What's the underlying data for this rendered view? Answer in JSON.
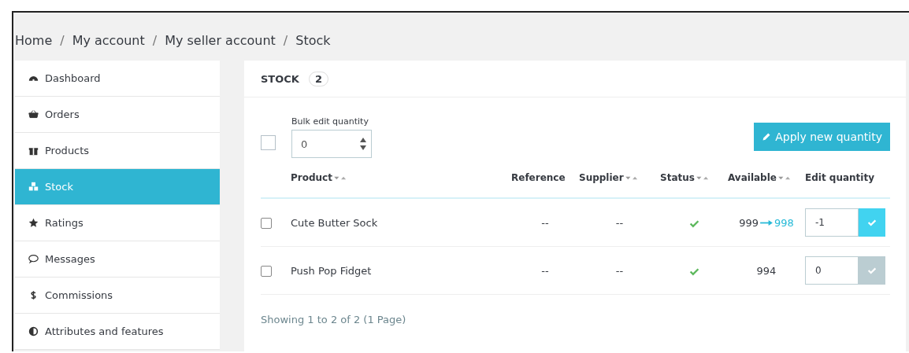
{
  "breadcrumb": [
    "Home",
    "My account",
    "My seller account",
    "Stock"
  ],
  "breadcrumb_separator": "/",
  "sidebar": {
    "items": [
      {
        "label": "Dashboard",
        "selected": false
      },
      {
        "label": "Orders",
        "selected": false
      },
      {
        "label": "Products",
        "selected": false
      },
      {
        "label": "Stock",
        "selected": true
      },
      {
        "label": "Ratings",
        "selected": false
      },
      {
        "label": "Messages",
        "selected": false
      },
      {
        "label": "Commissions",
        "selected": false
      },
      {
        "label": "Attributes and features",
        "selected": false
      }
    ]
  },
  "panel": {
    "title": "STOCK",
    "count": "2",
    "bulk": {
      "checked": false,
      "label": "Bulk edit quantity",
      "value": "0",
      "button": "Apply new quantity"
    },
    "table": {
      "columns": [
        {
          "label": "Product",
          "sortable": true
        },
        {
          "label": "Reference",
          "sortable": false
        },
        {
          "label": "Supplier",
          "sortable": true
        },
        {
          "label": "Status",
          "sortable": true
        },
        {
          "label": "Available",
          "sortable": true
        },
        {
          "label": "Edit quantity",
          "sortable": false
        }
      ],
      "rows": [
        {
          "checked": false,
          "product": "Cute Butter Sock",
          "reference": "--",
          "supplier": "--",
          "active": true,
          "available": "999",
          "new_available": "998",
          "edit_value": "-1",
          "changed": true
        },
        {
          "checked": false,
          "product": "Push Pop Fidget",
          "reference": "--",
          "supplier": "--",
          "active": true,
          "available": "994",
          "edit_value": "0",
          "changed": false
        }
      ]
    },
    "footer": "Showing 1 to 2 of 2 (1 Page)"
  }
}
